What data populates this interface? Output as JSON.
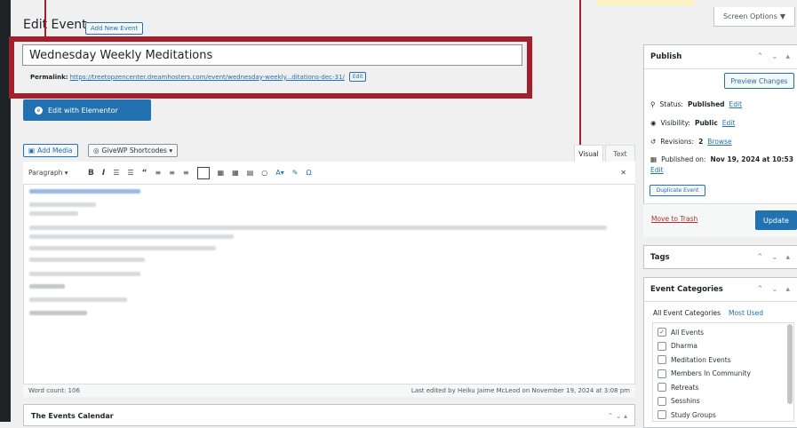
{
  "screen": {
    "options_label": "Screen Options",
    "options_arrow": "▼"
  },
  "header": {
    "title": "Edit Event",
    "add_new": "Add New Event"
  },
  "post": {
    "title": "Wednesday Weekly Meditations",
    "permalink_label": "Permalink:",
    "permalink_url": "https://treetopzencenter.dreamhosters.com/event/wednesday-weekly...ditations-dec-31/",
    "permalink_edit": "Edit"
  },
  "elementor": {
    "label": "Edit with Elementor"
  },
  "media": {
    "add_media": "Add Media",
    "givewp": "GiveWP Shortcodes ▾"
  },
  "editor": {
    "tab_visual": "Visual",
    "tab_text": "Text",
    "format_select": "Paragraph ▾",
    "word_count": "Word count: 106",
    "last_edited": "Last edited by Heiku Jaime McLeod on November 19, 2024 at 3:08 pm"
  },
  "bottom_box": {
    "title": "The Events Calendar",
    "controls": "⌃ ⌄ ▴"
  },
  "publish": {
    "title": "Publish",
    "controls": "⌃ ⌄ ▴",
    "preview": "Preview Changes",
    "status_label": "Status:",
    "status_value": "Published",
    "status_edit": "Edit",
    "visibility_label": "Visibility:",
    "visibility_value": "Public",
    "visibility_edit": "Edit",
    "revisions_label": "Revisions:",
    "revisions_value": "2",
    "revisions_browse": "Browse",
    "published_label": "Published on:",
    "published_value": "Nov 19, 2024 at 10:53",
    "published_edit": "Edit",
    "duplicate": "Duplicate Event",
    "trash": "Move to Trash",
    "update": "Update"
  },
  "tags": {
    "title": "Tags",
    "controls": "⌃ ⌄ ▴"
  },
  "categories": {
    "title": "Event Categories",
    "controls": "⌃ ⌄ ▴",
    "tab_all": "All Event Categories",
    "tab_used": "Most Used",
    "items": [
      {
        "label": "All Events",
        "checked": true
      },
      {
        "label": "Dharma",
        "checked": false
      },
      {
        "label": "Meditation Events",
        "checked": false
      },
      {
        "label": "Members In Community",
        "checked": false
      },
      {
        "label": "Retreats",
        "checked": false
      },
      {
        "label": "Sesshins",
        "checked": false
      },
      {
        "label": "Study Groups",
        "checked": false
      }
    ]
  },
  "colors": {
    "accent": "#2271b1",
    "callout": "#a31f2c",
    "danger": "#b32d2e"
  }
}
